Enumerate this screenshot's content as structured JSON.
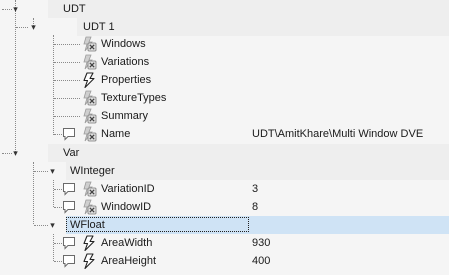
{
  "tree": {
    "udt": {
      "label": "UDT",
      "child": {
        "label": "UDT 1",
        "items": [
          {
            "label": "Windows",
            "icon": "disabled-function-icon",
            "value": ""
          },
          {
            "label": "Variations",
            "icon": "disabled-function-icon",
            "value": ""
          },
          {
            "label": "Properties",
            "icon": "lightning-icon",
            "value": ""
          },
          {
            "label": "TextureTypes",
            "icon": "disabled-function-icon",
            "value": ""
          },
          {
            "label": "Summary",
            "icon": "disabled-function-icon",
            "value": ""
          },
          {
            "label": "Name",
            "icon": "disabled-function-icon",
            "value": "UDT\\AmitKhare\\Multi Window DVE"
          }
        ]
      }
    },
    "var": {
      "label": "Var",
      "groups": [
        {
          "label": "WInteger",
          "items": [
            {
              "label": "VariationID",
              "icon": "disabled-function-icon",
              "value": "3"
            },
            {
              "label": "WindowID",
              "icon": "disabled-function-icon",
              "value": "8"
            }
          ]
        },
        {
          "label": "WFloat",
          "selected": true,
          "items": [
            {
              "label": "AreaWidth",
              "icon": "lightning-icon",
              "value": "930"
            },
            {
              "label": "AreaHeight",
              "icon": "lightning-icon",
              "value": "400"
            }
          ]
        }
      ]
    }
  },
  "colors": {
    "background": "#f5f5f5",
    "band": "#eeeeee",
    "selection": "#cfe3f5",
    "connector": "#8a8a8a"
  }
}
